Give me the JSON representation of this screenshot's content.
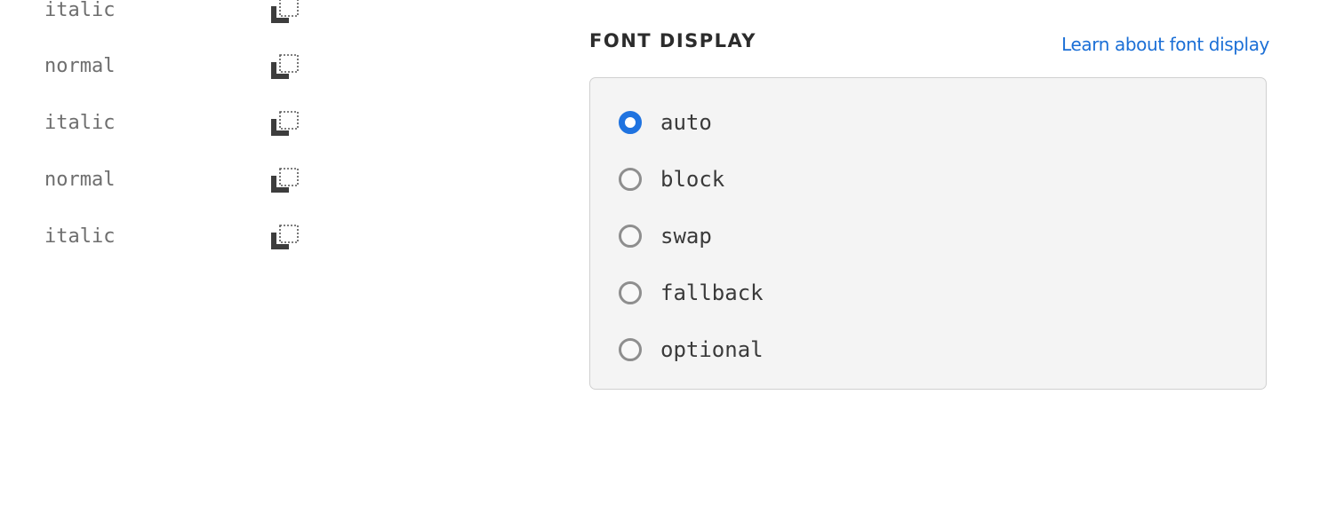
{
  "font_styles": [
    {
      "label": "italic",
      "copy_icon": "copy-icon"
    },
    {
      "label": "normal",
      "copy_icon": "copy-icon"
    },
    {
      "label": "italic",
      "copy_icon": "copy-icon"
    },
    {
      "label": "normal",
      "copy_icon": "copy-icon"
    },
    {
      "label": "italic",
      "copy_icon": "copy-icon"
    }
  ],
  "font_display": {
    "title": "FONT DISPLAY",
    "learn_link": "Learn about font display",
    "selected": "auto",
    "options": [
      {
        "label": "auto",
        "checked": true
      },
      {
        "label": "block",
        "checked": false
      },
      {
        "label": "swap",
        "checked": false
      },
      {
        "label": "fallback",
        "checked": false
      },
      {
        "label": "optional",
        "checked": false
      }
    ]
  },
  "colors": {
    "accent": "#1f73e0",
    "link": "#1b6fd6",
    "panel_bg": "#f4f4f4"
  }
}
